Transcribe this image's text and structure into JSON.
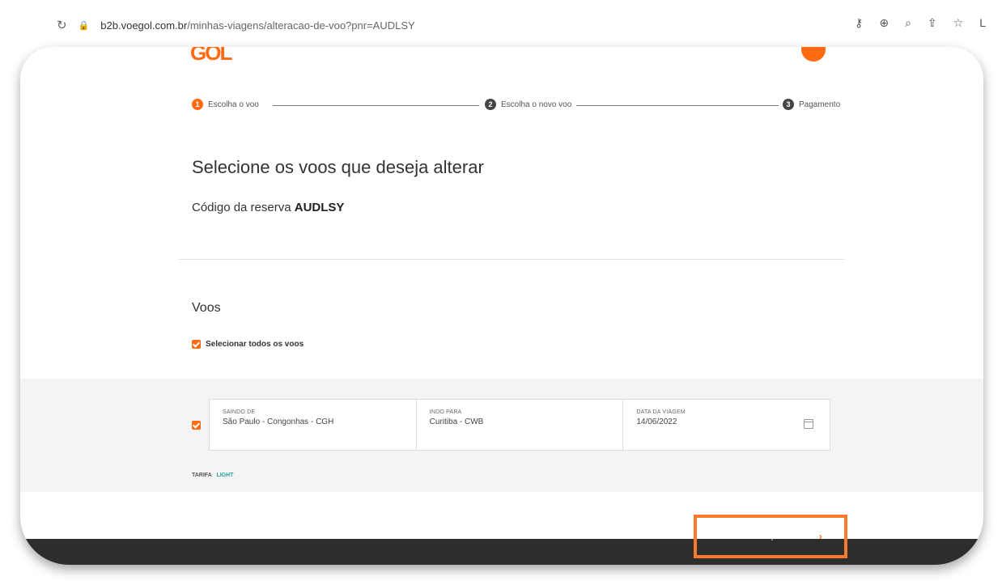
{
  "browser": {
    "url_host": "b2b.voegol.com.br",
    "url_path": "/minhas-viagens/alteracao-de-voo?pnr=AUDLSY",
    "reload_icon": "reload-icon",
    "lock_icon": "lock-icon"
  },
  "header": {
    "logo": "GOL",
    "user_text": "",
    "avatar": ""
  },
  "stepper": [
    {
      "num": "1",
      "label": "Escolha o voo",
      "active": true
    },
    {
      "num": "2",
      "label": "Escolha o novo voo",
      "active": false
    },
    {
      "num": "3",
      "label": "Pagamento",
      "active": false
    }
  ],
  "main": {
    "title": "Selecione os voos que deseja alterar",
    "booking_label": "Código da reserva",
    "booking_code": "AUDLSY",
    "flights_title": "Voos",
    "select_all_label": "Selecionar todos os voos"
  },
  "flight": {
    "from_label": "SAINDO DE",
    "from_value": "São Paulo - Congonhas - CGH",
    "to_label": "INDO PARA",
    "to_value": "Curitiba - CWB",
    "date_label": "DATA DA VIAGEM",
    "date_value": "14/06/2022",
    "fare_label": "TARIFA",
    "fare_value": "LIGHT"
  },
  "footer": {
    "go_button_label": "IR PARA A SELEÇÃO DE VOO"
  },
  "colors": {
    "accent": "#ff6a13",
    "dark_bar": "#2e2e2e",
    "fare_color": "#2a9d9a"
  }
}
